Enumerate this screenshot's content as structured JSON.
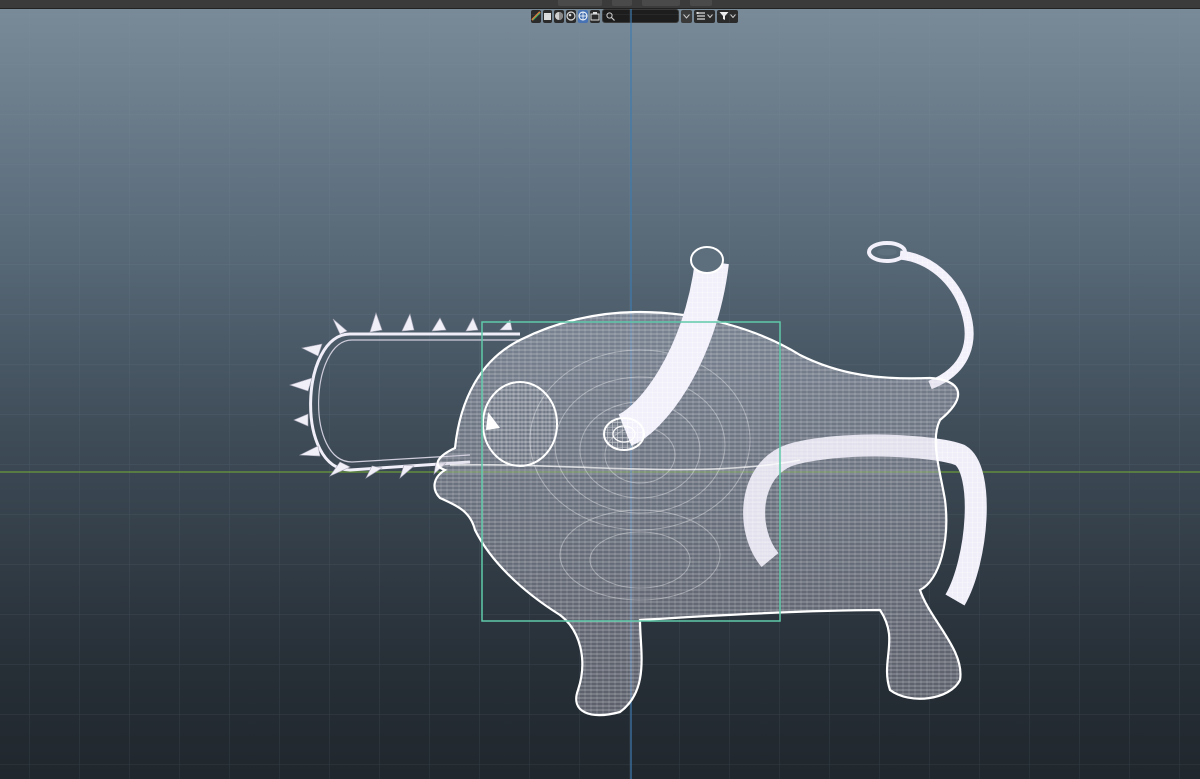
{
  "header": {
    "mode_buttons": [
      {
        "icon": "palette-icon"
      },
      {
        "icon": "object-icon"
      },
      {
        "icon": "shading-solid-icon"
      },
      {
        "icon": "shading-material-icon"
      },
      {
        "icon": "shading-wireframe-icon"
      },
      {
        "icon": "camera-icon"
      }
    ],
    "search": {
      "placeholder": "",
      "icon": "search-icon"
    },
    "display_dropdown_icon": "display-filter-icon",
    "filter_icon": "filter-icon"
  },
  "colors": {
    "wire": "#e9e6f3",
    "selection_box": "#5fcaa9",
    "x_axis": "#6a9a3c",
    "y_axis": "#3f7bb0"
  }
}
